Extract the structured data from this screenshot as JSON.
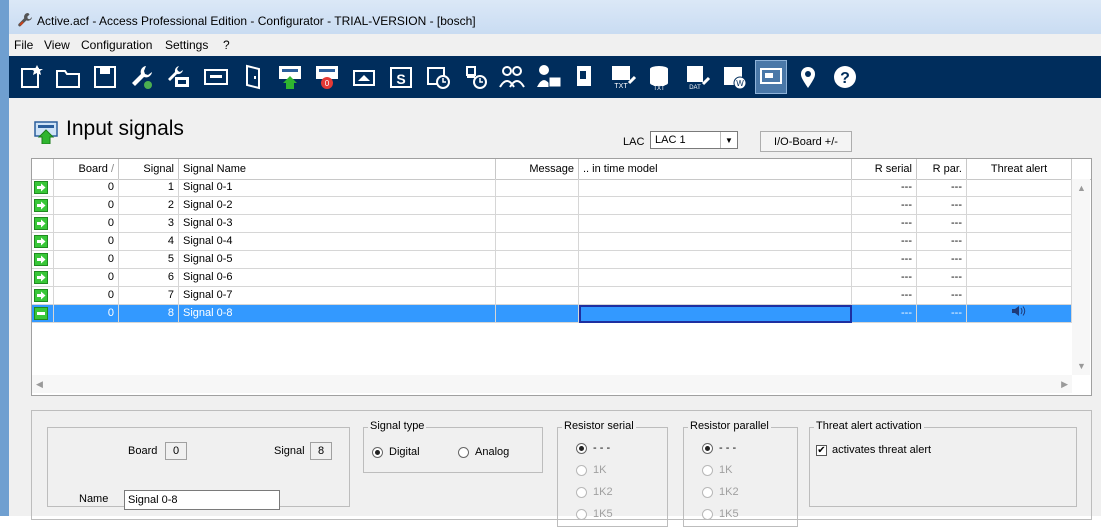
{
  "window": {
    "title": "Active.acf - Access Professional Edition - Configurator - TRIAL-VERSION - [bosch]"
  },
  "menu": [
    "File",
    "View",
    "Configuration",
    "Settings",
    "?"
  ],
  "toolbar": {
    "icons": [
      "new-icon",
      "open-folder-icon",
      "save-icon",
      "configure-wrench-icon",
      "network-config-icon",
      "card-reader-icon",
      "door-icon",
      "input-signal-icon",
      "output-signal-icon",
      "display-icon",
      "special-day-icon",
      "time-model-icon",
      "time-profile-icon",
      "persons-group-icon",
      "person-data-icon",
      "card-definition-icon",
      "text-export-icon",
      "database-export-icon",
      "data-export-icon",
      "web-export-icon",
      "monitor-icon",
      "location-pin-icon",
      "help-icon"
    ],
    "active_index": 20
  },
  "page": {
    "title": "Input signals"
  },
  "lac": {
    "label": "LAC",
    "value": "LAC 1"
  },
  "io_button": "I/O-Board +/-",
  "table": {
    "headers": [
      "Board",
      "Signal",
      "Signal Name",
      "Message",
      ".. in time model",
      "R serial",
      "R par.",
      "Threat alert"
    ],
    "rows": [
      {
        "board": "0",
        "signal": "1",
        "name": "Signal 0-1",
        "message": "",
        "time_model": "",
        "r_serial": "---",
        "r_par": "---",
        "threat": ""
      },
      {
        "board": "0",
        "signal": "2",
        "name": "Signal 0-2",
        "message": "",
        "time_model": "",
        "r_serial": "---",
        "r_par": "---",
        "threat": ""
      },
      {
        "board": "0",
        "signal": "3",
        "name": "Signal 0-3",
        "message": "",
        "time_model": "",
        "r_serial": "---",
        "r_par": "---",
        "threat": ""
      },
      {
        "board": "0",
        "signal": "4",
        "name": "Signal 0-4",
        "message": "",
        "time_model": "",
        "r_serial": "---",
        "r_par": "---",
        "threat": ""
      },
      {
        "board": "0",
        "signal": "5",
        "name": "Signal 0-5",
        "message": "",
        "time_model": "",
        "r_serial": "---",
        "r_par": "---",
        "threat": ""
      },
      {
        "board": "0",
        "signal": "6",
        "name": "Signal 0-6",
        "message": "",
        "time_model": "",
        "r_serial": "---",
        "r_par": "---",
        "threat": ""
      },
      {
        "board": "0",
        "signal": "7",
        "name": "Signal 0-7",
        "message": "",
        "time_model": "",
        "r_serial": "---",
        "r_par": "---",
        "threat": ""
      },
      {
        "board": "0",
        "signal": "8",
        "name": "Signal 0-8",
        "message": "",
        "time_model": "",
        "r_serial": "---",
        "r_par": "---",
        "threat": "speaker-icon"
      }
    ],
    "selected_row": 7,
    "colors": {
      "row_indicator": "#38c738",
      "selection": "#3399ff"
    }
  },
  "detail": {
    "board_label": "Board",
    "board_value": "0",
    "signal_label": "Signal",
    "signal_value": "8",
    "name_label": "Name",
    "name_value": "Signal 0-8",
    "signal_type": {
      "title": "Signal type",
      "options": [
        "Digital",
        "Analog"
      ],
      "selected": "Digital"
    },
    "resistor_serial": {
      "title": "Resistor serial",
      "options": [
        "- - -",
        "1K",
        "1K2",
        "1K5"
      ],
      "selected": "- - -"
    },
    "resistor_parallel": {
      "title": "Resistor parallel",
      "options": [
        "- - -",
        "1K",
        "1K2",
        "1K5"
      ],
      "selected": "- - -"
    },
    "threat_alert": {
      "title": "Threat alert activation",
      "checkbox_label": "activates threat alert",
      "checked": true
    }
  }
}
